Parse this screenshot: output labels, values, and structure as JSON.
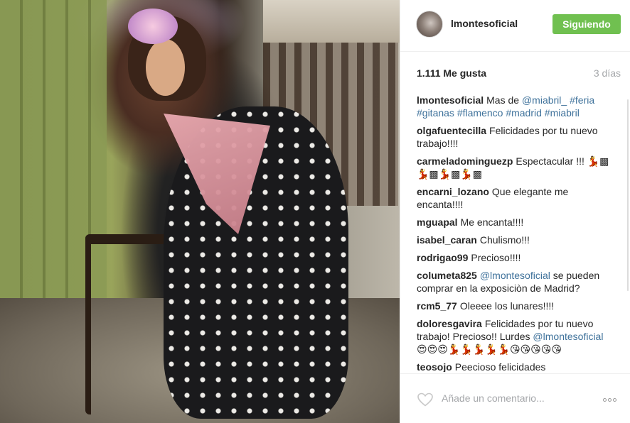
{
  "post": {
    "author": "lmontesoficial",
    "follow_button": "Siguiendo",
    "likes": "1.111 Me gusta",
    "time_ago": "3 días"
  },
  "comments": [
    {
      "user": "lmontesoficial",
      "parts": [
        {
          "t": "Mas de "
        },
        {
          "t": "@miabril_",
          "link": true
        },
        {
          "t": " "
        },
        {
          "t": "#feria",
          "link": true
        },
        {
          "t": " "
        },
        {
          "t": "#gitanas",
          "link": true
        },
        {
          "t": " "
        },
        {
          "t": "#flamenco",
          "link": true
        },
        {
          "t": " "
        },
        {
          "t": "#madrid",
          "link": true
        },
        {
          "t": " "
        },
        {
          "t": "#miabril",
          "link": true
        }
      ]
    },
    {
      "user": "olgafuentecilla",
      "parts": [
        {
          "t": "Felicidades por tu nuevo trabajo!!!!"
        }
      ]
    },
    {
      "user": "carmeladominguezp",
      "parts": [
        {
          "t": "Espectacular !!! 💃▩💃▩💃▩💃▩"
        }
      ]
    },
    {
      "user": "encarni_lozano",
      "parts": [
        {
          "t": "Que elegante me encanta!!!!"
        }
      ]
    },
    {
      "user": "mguapal",
      "parts": [
        {
          "t": "Me encanta!!!!"
        }
      ]
    },
    {
      "user": "isabel_caran",
      "parts": [
        {
          "t": "Chulismo!!!"
        }
      ]
    },
    {
      "user": "rodrigao99",
      "parts": [
        {
          "t": "Precioso!!!!"
        }
      ]
    },
    {
      "user": "columeta825",
      "parts": [
        {
          "t": "@lmontesoficial",
          "link": true
        },
        {
          "t": " se pueden comprar en la exposiciòn de Madrid?"
        }
      ]
    },
    {
      "user": "rcm5_77",
      "parts": [
        {
          "t": "Oleeee los lunares!!!!"
        }
      ]
    },
    {
      "user": "doloresgavira",
      "parts": [
        {
          "t": "Felicidades por tu nuevo trabajo! Precioso!! Lurdes "
        },
        {
          "t": "@lmontesoficial",
          "link": true
        },
        {
          "t": " 😍😍😍💃💃💃💃💃😘😘😘😘😘"
        }
      ]
    },
    {
      "user": "teosojo",
      "parts": [
        {
          "t": "Peecioso felicidades"
        }
      ]
    }
  ],
  "footer": {
    "comment_placeholder": "Añade un comentario...",
    "like_icon": "heart-outline-icon",
    "more_icon": "more-options-icon"
  },
  "colors": {
    "follow_bg": "#70c050",
    "link": "#3f729b",
    "muted": "#a5a7aa"
  }
}
